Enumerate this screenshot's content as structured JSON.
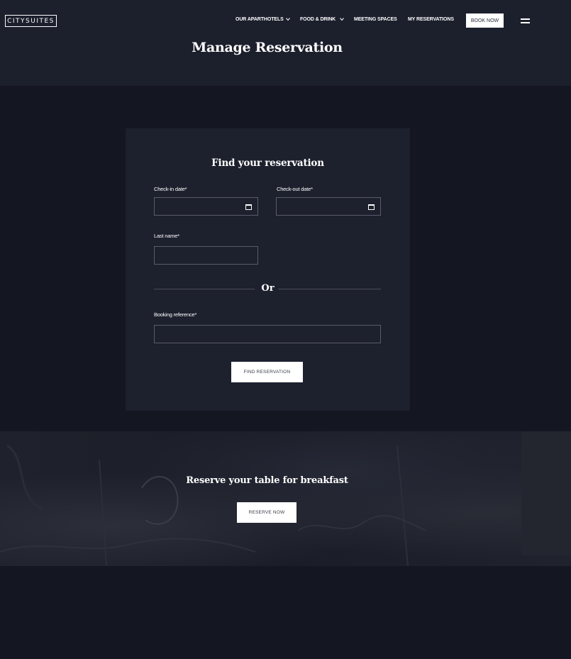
{
  "header": {
    "logo_text": "CITYSUITES",
    "nav": {
      "aparthotels": "OUR APARTHOTELS",
      "food_drink": "FOOD & DRINK",
      "meeting_spaces": "MEETING SPACES",
      "my_reservations": "MY RESERVATIONS"
    },
    "book_now": "BOOK NOW",
    "menu_icon": "hamburger-icon",
    "dropdown_icon": "chevron-down-icon"
  },
  "page_title": "Manage Reservation",
  "form": {
    "title": "Find your reservation",
    "checkin_label": "Check-in date*",
    "checkin_value": "",
    "checkout_label": "Check-out date*",
    "checkout_value": "",
    "calendar_icon": "calendar-icon",
    "lastname_label": "Last name*",
    "lastname_value": "",
    "or_text": "Or",
    "booking_ref_label": "Booking reference*",
    "booking_ref_value": "",
    "submit_label": "FIND RESERVATION"
  },
  "banner": {
    "title": "Reserve your table for breakfast",
    "button_label": "RESERVE NOW"
  },
  "colors": {
    "page_bg": "#141722",
    "header_bg": "#1c1f2c",
    "card_bg": "#1d202d",
    "button_bg": "#ffffff"
  }
}
